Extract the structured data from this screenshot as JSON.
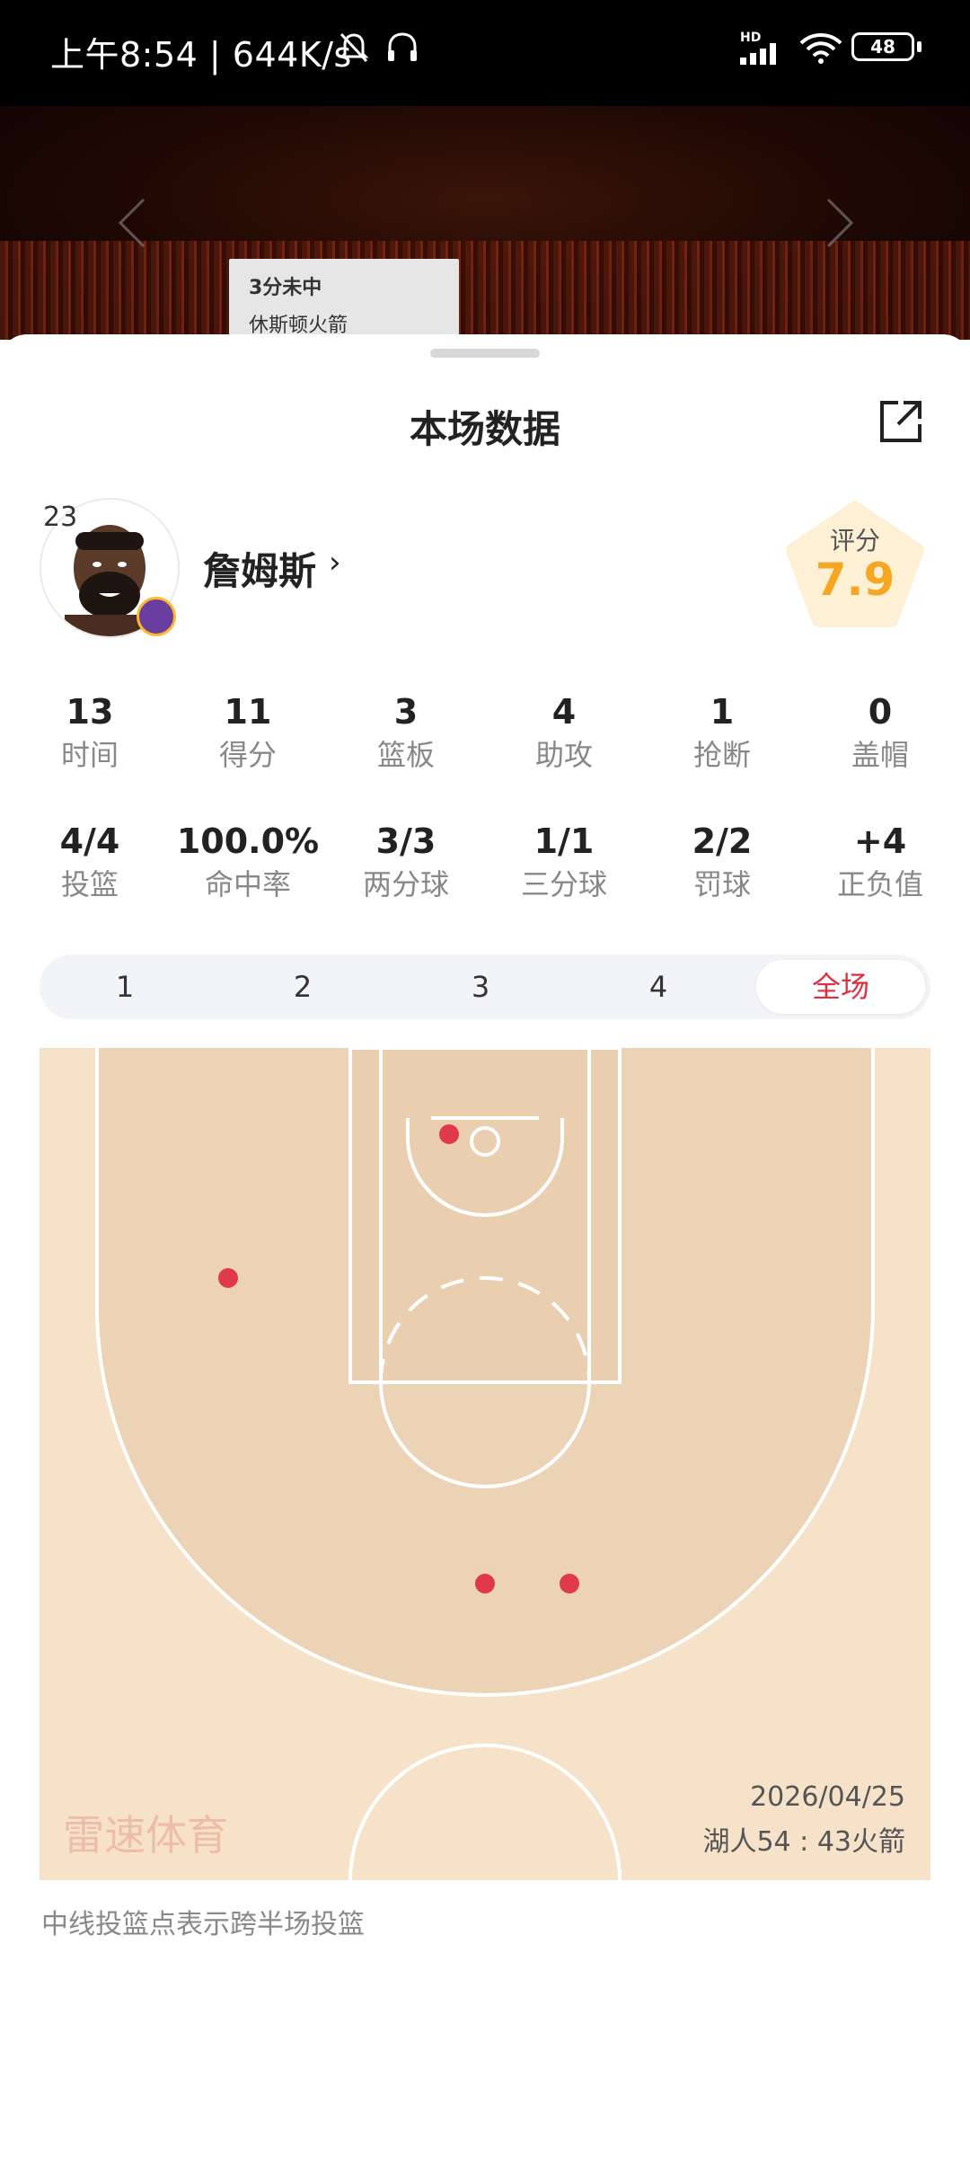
{
  "status_bar": {
    "time_speed": "上午8:54 | 644K/s",
    "network": "HD",
    "battery": "48"
  },
  "background": {
    "popup_line1": "3分未中",
    "popup_line2": "休斯顿火箭"
  },
  "sheet": {
    "title": "本场数据"
  },
  "player": {
    "jersey": "23",
    "name": "詹姆斯",
    "rating_label": "评分",
    "rating": "7.9"
  },
  "stats_row1": [
    {
      "value": "13",
      "label": "时间"
    },
    {
      "value": "11",
      "label": "得分"
    },
    {
      "value": "3",
      "label": "篮板"
    },
    {
      "value": "4",
      "label": "助攻"
    },
    {
      "value": "1",
      "label": "抢断"
    },
    {
      "value": "0",
      "label": "盖帽"
    }
  ],
  "stats_row2": [
    {
      "value": "4/4",
      "label": "投篮"
    },
    {
      "value": "100.0%",
      "label": "命中率"
    },
    {
      "value": "3/3",
      "label": "两分球"
    },
    {
      "value": "1/1",
      "label": "三分球"
    },
    {
      "value": "2/2",
      "label": "罚球"
    },
    {
      "value": "+4",
      "label": "正负值"
    }
  ],
  "quarters": {
    "tabs": [
      "1",
      "2",
      "3",
      "4",
      "全场"
    ],
    "selected": "全场"
  },
  "court": {
    "date": "2026/04/25",
    "score": "湖人54 : 43火箭",
    "watermark": "雷速体育"
  },
  "footnote": "中线投篮点表示跨半场投篮",
  "colors": {
    "accent": "#e02d3c",
    "rating": "#f5a623",
    "court_floor": "#f6e2c8",
    "court_paint": "#ecd3b6",
    "shot_dot": "#e0394a"
  }
}
